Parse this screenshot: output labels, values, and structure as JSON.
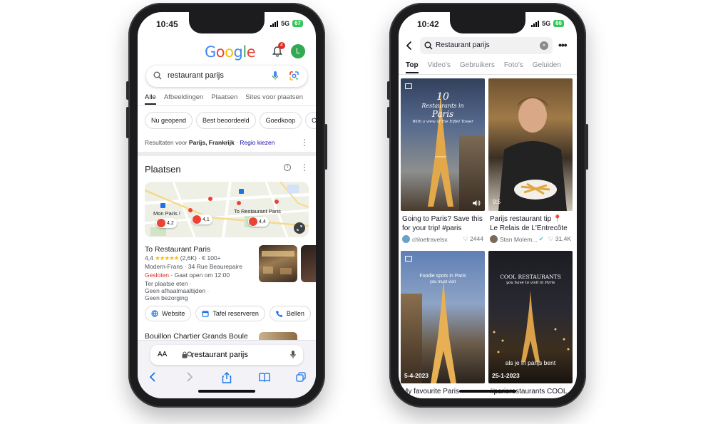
{
  "left_phone": {
    "status": {
      "time": "10:45",
      "network": "5G",
      "battery": "67"
    },
    "google_logo": "Google",
    "notification_count": "4",
    "avatar_letter": "L",
    "search_query": "restaurant parijs",
    "tabs": [
      "Alle",
      "Afbeeldingen",
      "Plaatsen",
      "Sites voor plaatsen"
    ],
    "chips": [
      "Nu geopend",
      "Best beoordeeld",
      "Goedkoop",
      "Ch"
    ],
    "results_for": {
      "prefix": "Resultaten voor",
      "place": "Parijs, Frankrijk",
      "link": "Regio kiezen"
    },
    "places_title": "Plaatsen",
    "map": {
      "labels": [
        "Mon Paris !",
        "To Restaurant Paris"
      ],
      "pins": [
        "4,2",
        "4,1",
        "4,4"
      ]
    },
    "result": {
      "name": "To Restaurant Paris",
      "rating": "4,4",
      "stars": "★★★★★",
      "review_count": "(2,6K)",
      "price": "€ 100+",
      "category_address": "Modern-Frans · 34 Rue Beaurepaire",
      "status_closed": "Gesloten",
      "opening": "· Gaat open om 12:00",
      "services": [
        "Ter plaatse eten ·",
        "Geen afhaalmaaltijden ·",
        "Geen bezorging"
      ]
    },
    "actions": [
      "Website",
      "Tafel reserveren",
      "Bellen"
    ],
    "next_result": "Bouillon Chartier Grands Boule",
    "safari": {
      "aa": "AA",
      "url": "restaurant parijs"
    }
  },
  "right_phone": {
    "status": {
      "time": "10:42",
      "network": "5G",
      "battery": "66"
    },
    "search_query": "Restaurant parijs",
    "tabs": [
      "Top",
      "Video's",
      "Gebruikers",
      "Foto's",
      "Geluiden"
    ],
    "tiles": [
      {
        "overlay_number": "10",
        "overlay_title": "Restaurants in",
        "overlay_city": "Paris",
        "overlay_sub": "With a view of the Eiffel Tower",
        "caption": "Going to Paris?  Save this for your trip! #paris",
        "user": "chloetravelsx",
        "likes": "2444"
      },
      {
        "duration": "9:5",
        "caption": "Parijs restaurant tip 📍 Le Relais de L'Entrecôte",
        "user": "Stan Molem...",
        "likes": "31,4K"
      },
      {
        "overlay_title": "Foodie spots in Paris",
        "overlay_sub": "you must visit",
        "date": "5-4-2023",
        "caption": "My favourite Paris"
      },
      {
        "overlay_title": "COOL RESTAURANTS",
        "overlay_sub": "you have to visit in Paris",
        "overlay_bottom": "als je in parijs bent",
        "date": "25-1-2023",
        "caption": "#parisrestaurants COOL"
      }
    ]
  }
}
